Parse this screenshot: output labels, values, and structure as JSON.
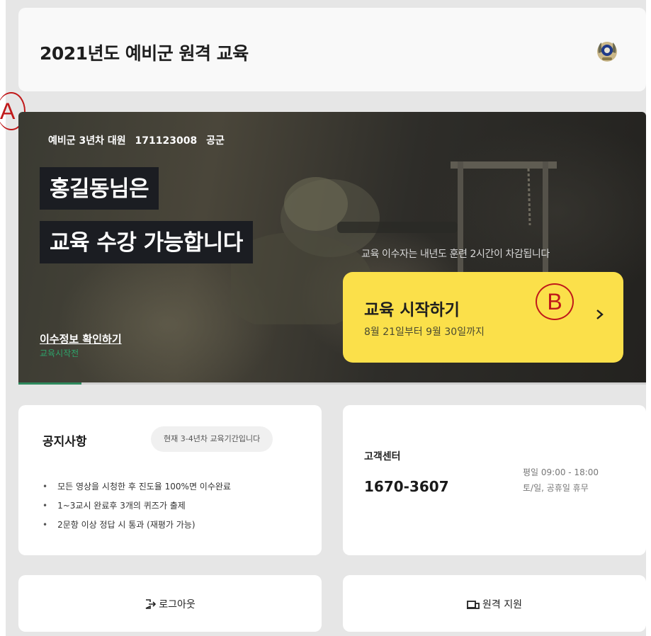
{
  "header": {
    "title": "2021년도 예비군 원격 교육",
    "emblem_icon": "army-emblem-icon"
  },
  "hero": {
    "info": {
      "rank_year": "예비군 3년차 대원",
      "service_number": "171123008",
      "branch": "공군"
    },
    "greeting_line1": "홍길동님은",
    "greeting_line2": "교육 수강 가능합니다",
    "deduction_note": "교육 이수자는 내년도 훈련 2시간이 차감됩니다",
    "start_button": {
      "title": "교육 시작하기",
      "period": "8월 21일부터 9월 30일까지",
      "chevron_icon": "chevron-right-icon"
    },
    "completion_link": "이수정보 확인하기",
    "status": "교육시작전",
    "progress_fraction": 0.1
  },
  "annotations": {
    "marker_a": "A",
    "marker_b": "B"
  },
  "notice": {
    "title": "공지사항",
    "badge": "현재 3-4년차 교육기간입니다",
    "items": [
      "모든 영상을 시청한 후 진도율 100%면 이수완료",
      "1~3교시 완료후 3개의 퀴즈가 출제",
      "2문항 이상 정답 시 통과 (재평가 가능)"
    ]
  },
  "support": {
    "title": "고객센터",
    "phone": "1670-3607",
    "weekday_hours": "평일 09:00 - 18:00",
    "weekend_hours": "토/일, 공휴일 휴무"
  },
  "actions": {
    "logout_label": "로그아웃",
    "logout_icon": "logout-icon",
    "remote_label": "원격 지원",
    "remote_icon": "remote-support-icon"
  },
  "colors": {
    "accent_yellow": "#fbe04a",
    "progress_green": "#2f8a5e",
    "status_green": "#2ea36a",
    "marker_red": "#c0191a"
  }
}
